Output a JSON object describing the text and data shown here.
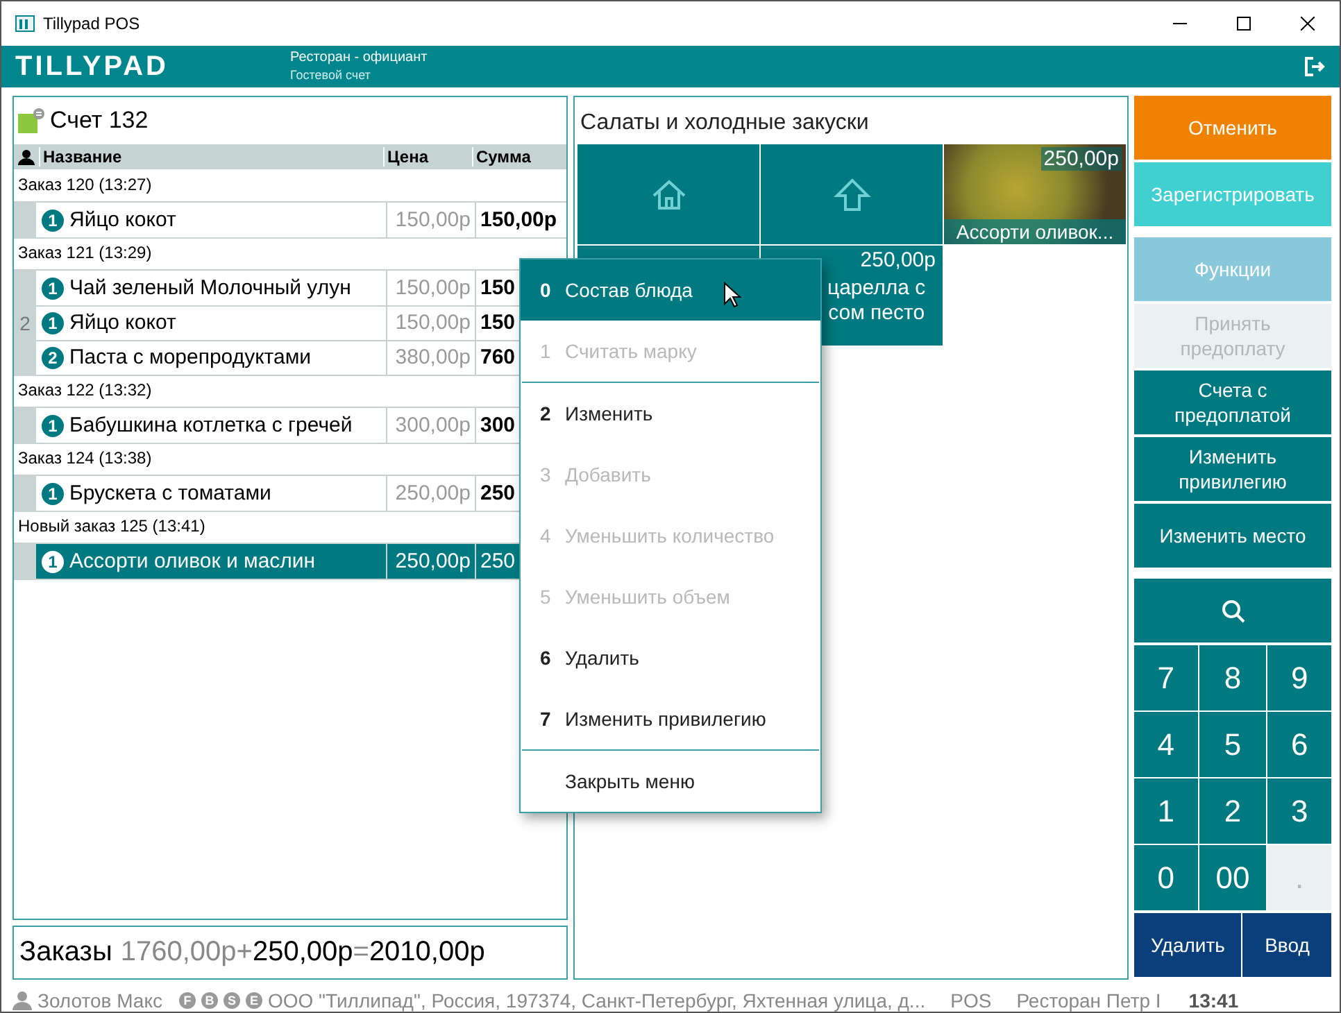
{
  "window": {
    "title": "Tillypad POS"
  },
  "header": {
    "logo": "TILLYPAD",
    "role": "Ресторан - официант",
    "mode": "Гостевой счет"
  },
  "check": {
    "title": "Счет 132",
    "columns": [
      "Название",
      "Цена",
      "Сумма"
    ],
    "orders": [
      {
        "title": "Заказ 120 (13:27)",
        "items": [
          {
            "qty": "1",
            "name": "Яйцо кокот",
            "price": "150,00р",
            "sum": "150,00р",
            "selected": false
          }
        ]
      },
      {
        "title": "Заказ 121 (13:29)",
        "items": [
          {
            "qty": "1",
            "name": "Чай зеленый Молочный улун",
            "price": "150,00р",
            "sum": "150",
            "selected": false
          },
          {
            "seat": "2",
            "qty": "1",
            "name": "Яйцо кокот",
            "price": "150,00р",
            "sum": "150",
            "selected": false
          },
          {
            "qty": "2",
            "name": "Паста с морепродуктами",
            "price": "380,00р",
            "sum": "760",
            "selected": false
          }
        ]
      },
      {
        "title": "Заказ 122 (13:32)",
        "items": [
          {
            "qty": "1",
            "name": "Бабушкина котлетка с гречей",
            "price": "300,00р",
            "sum": "300",
            "selected": false
          }
        ]
      },
      {
        "title": "Заказ 124 (13:38)",
        "items": [
          {
            "qty": "1",
            "name": "Брускета с томатами",
            "price": "250,00р",
            "sum": "250",
            "selected": false
          }
        ]
      },
      {
        "title": "Новый заказ 125 (13:41)",
        "items": [
          {
            "qty": "1",
            "name": "Ассорти оливок и маслин",
            "price": "250,00р",
            "sum": "250",
            "selected": true
          }
        ]
      }
    ]
  },
  "totals": {
    "label": "Заказы",
    "ordered": "1760,00р",
    "plus": "+",
    "added": "250,00р",
    "equals": "=",
    "total": "2010,00р"
  },
  "menu_panel": {
    "title": "Салаты и холодные закуски",
    "tiles": [
      {
        "kind": "home"
      },
      {
        "kind": "up"
      },
      {
        "kind": "photo",
        "price": "250,00р",
        "name": "Ассорти оливок..."
      },
      {
        "kind": "covered"
      },
      {
        "kind": "dish",
        "price": "250,00р",
        "name_lines": [
          "царелла с",
          "сом песто"
        ]
      }
    ]
  },
  "actions": [
    {
      "label": "Отменить",
      "kind": "accent",
      "disabled": false
    },
    {
      "label": "Зарегистрировать",
      "kind": "bright",
      "disabled": false
    },
    {
      "label": "Функции",
      "kind": "soft",
      "disabled": false
    },
    {
      "label": "Принять предоплату",
      "kind": "plain",
      "disabled": true
    },
    {
      "label": "Счета с предоплатой",
      "kind": "plain",
      "disabled": false
    },
    {
      "label": "Изменить привилегию",
      "kind": "plain",
      "disabled": false
    },
    {
      "label": "Изменить место",
      "kind": "plain",
      "disabled": false
    }
  ],
  "keypad": {
    "keys": [
      {
        "label": "7",
        "disabled": false
      },
      {
        "label": "8",
        "disabled": false
      },
      {
        "label": "9",
        "disabled": false
      },
      {
        "label": "4",
        "disabled": false
      },
      {
        "label": "5",
        "disabled": false
      },
      {
        "label": "6",
        "disabled": false
      },
      {
        "label": "1",
        "disabled": false
      },
      {
        "label": "2",
        "disabled": false
      },
      {
        "label": "3",
        "disabled": false
      },
      {
        "label": "0",
        "disabled": false
      },
      {
        "label": "00",
        "disabled": false
      },
      {
        "label": ".",
        "disabled": true
      }
    ],
    "actions": [
      "Удалить",
      "Ввод"
    ]
  },
  "context_menu": {
    "items": [
      {
        "kind": "item",
        "key": "0",
        "label": "Состав блюда",
        "selected": true,
        "disabled": false
      },
      {
        "kind": "item",
        "key": "1",
        "label": "Считать марку",
        "selected": false,
        "disabled": true
      },
      {
        "kind": "separator"
      },
      {
        "kind": "item",
        "key": "2",
        "label": "Изменить",
        "selected": false,
        "disabled": false
      },
      {
        "kind": "item",
        "key": "3",
        "label": "Добавить",
        "selected": false,
        "disabled": true
      },
      {
        "kind": "item",
        "key": "4",
        "label": "Уменьшить количество",
        "selected": false,
        "disabled": true
      },
      {
        "kind": "item",
        "key": "5",
        "label": "Уменьшить объем",
        "selected": false,
        "disabled": true
      },
      {
        "kind": "item",
        "key": "6",
        "label": "Удалить",
        "selected": false,
        "disabled": false
      },
      {
        "kind": "item",
        "key": "7",
        "label": "Изменить привилегию",
        "selected": false,
        "disabled": false
      },
      {
        "kind": "separator"
      },
      {
        "kind": "item",
        "label": "Закрыть меню",
        "selected": false,
        "disabled": false
      }
    ]
  },
  "status_bar": {
    "user": "Золотов Макс",
    "badges": [
      "F",
      "B",
      "S",
      "E"
    ],
    "company": "ООО \"Тиллипад\", Россия, 197374, Санкт-Петербург, Яхтенная улица, д...",
    "terminal": "POS",
    "venue": "Ресторан Петр I",
    "time": "13:41"
  }
}
